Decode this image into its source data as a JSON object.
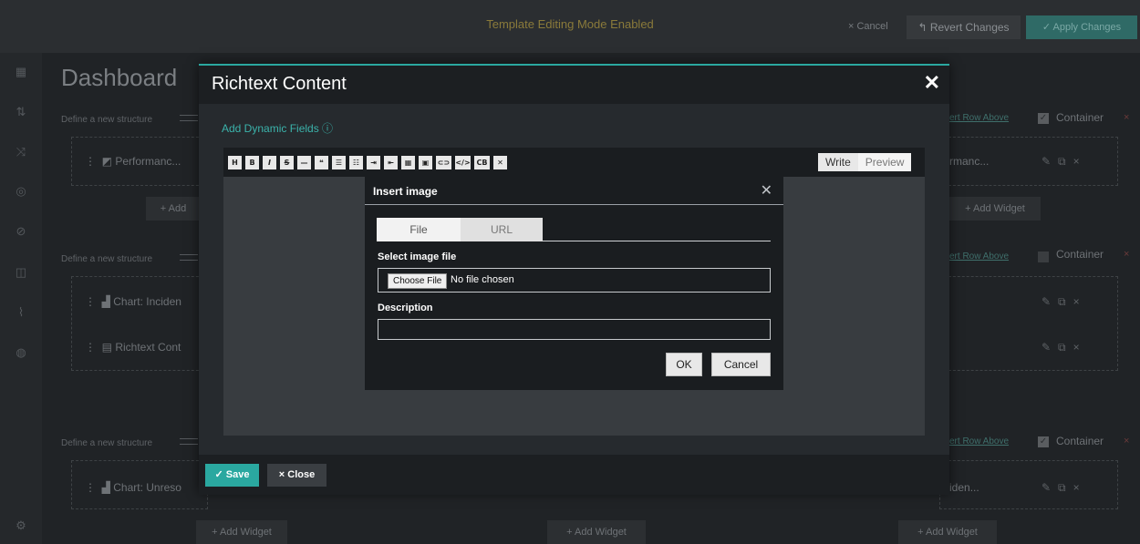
{
  "topbar": {
    "mode_text": "Template Editing Mode Enabled",
    "cancel_label": "× Cancel",
    "revert_label": "↰ Revert Changes",
    "apply_label": "✓ Apply Changes"
  },
  "dashboard": {
    "title": "Dashboard",
    "structure_label": "Define a new structure",
    "insert_row_link": "ert Row Above",
    "container_label": "Container",
    "add_widget_label": "+ Add Widget",
    "add_label_partial": "+ Add",
    "widgets": {
      "left_perf": "Performanc...",
      "right_perf": "rmanc...",
      "chart_incidents": "Chart: Inciden",
      "richtext": "Richtext Cont",
      "chart_unresolved": "Chart: Unreso",
      "right_iden": "iden..."
    }
  },
  "modal": {
    "title": "Richtext Content",
    "add_dynamic_fields": "Add Dynamic Fields ⓘ",
    "save_label": "✓ Save",
    "close_label": "× Close",
    "toolbar_buttons": [
      "H",
      "B",
      "I",
      "S",
      "—",
      "❝",
      "☰",
      "☷",
      "⇥",
      "⇤",
      "▦",
      "▣",
      "⊂⊃",
      "</>",
      "CB",
      "✕"
    ],
    "write_tab": "Write",
    "preview_tab": "Preview"
  },
  "insert_image": {
    "title": "Insert image",
    "tab_file": "File",
    "tab_url": "URL",
    "select_label": "Select image file",
    "choose_file": "Choose File",
    "no_file": "No file chosen",
    "description_label": "Description",
    "description_value": "",
    "ok_label": "OK",
    "cancel_label": "Cancel"
  },
  "colors": {
    "accent": "#2aa8a0",
    "background": "#202326",
    "modal": "#262a2e"
  }
}
